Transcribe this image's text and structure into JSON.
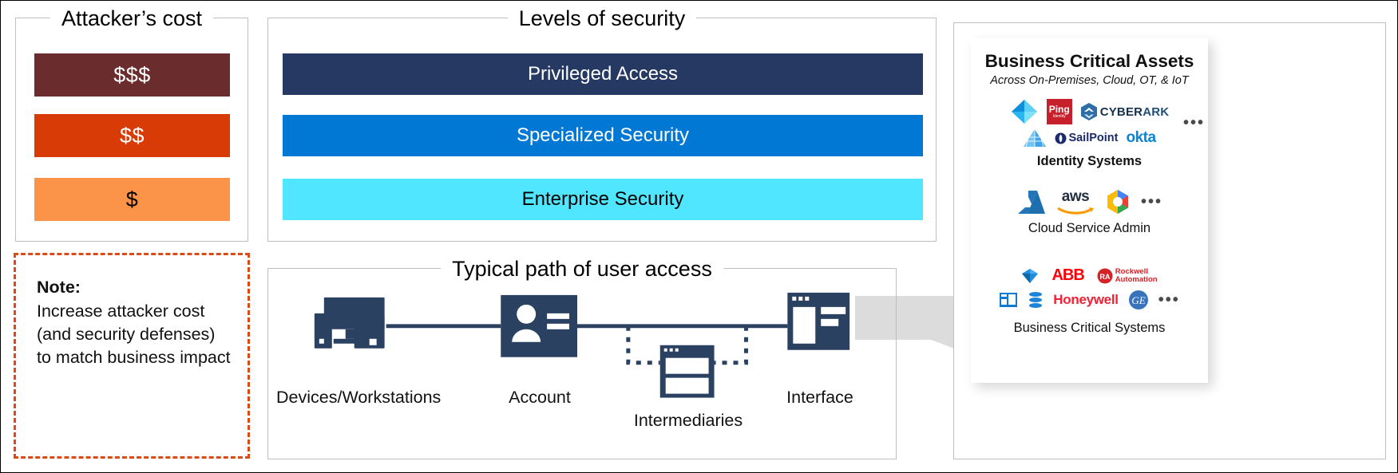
{
  "attacker_cost": {
    "title": "Attacker’s cost",
    "bars": [
      {
        "label": "$$$",
        "color": "#6a2c2c"
      },
      {
        "label": "$$",
        "color": "#d93b07"
      },
      {
        "label": "$",
        "color": "#fb9449"
      }
    ]
  },
  "note": {
    "heading": "Note:",
    "body": "Increase attacker cost (and security defenses) to match business impact",
    "border_color": "#d94b18"
  },
  "levels": {
    "title": "Levels of security",
    "bars": [
      {
        "label": "Privileged Access",
        "color": "#263963"
      },
      {
        "label": "Specialized Security",
        "color": "#0078d4"
      },
      {
        "label": "Enterprise Security",
        "color": "#50e6ff"
      }
    ]
  },
  "path": {
    "title": "Typical path of user access",
    "nodes": [
      {
        "label": "Devices/Workstations",
        "icon": "workstation-icon"
      },
      {
        "label": "Account",
        "icon": "account-card-icon"
      },
      {
        "label": "Intermediaries",
        "icon": "intermediary-window-icon"
      },
      {
        "label": "Interface",
        "icon": "interface-window-icon"
      }
    ]
  },
  "assets": {
    "title": "Business Critical Assets",
    "subtitle": "Across On-Premises, Cloud, OT, & IoT",
    "groups": [
      {
        "caption": "Identity Systems",
        "logos": [
          "azure-ad-diamond-icon",
          "ping-identity-logo",
          "cyberark-logo",
          "adfs-pyramid-icon",
          "sailpoint-logo",
          "okta-logo",
          "more-dots-icon"
        ],
        "logo_text": {
          "ping": "Ping",
          "ping_sub": "Identity",
          "cyberark_a": "CYBER",
          "cyberark_b": "ARK",
          "sailpoint": "SailPoint",
          "okta": "okta",
          "dots": "•••"
        }
      },
      {
        "caption": "Cloud Service Admin",
        "logos": [
          "azure-logo",
          "aws-logo",
          "google-cloud-logo",
          "more-dots-icon"
        ],
        "logo_text": {
          "aws": "aws",
          "dots": "•••"
        }
      },
      {
        "caption": "Business Critical Systems",
        "logos": [
          "sap-diamond-icon",
          "abb-logo",
          "rockwell-automation-logo",
          "dynamics-icon",
          "oracle-db-icon",
          "honeywell-logo",
          "ge-logo",
          "more-dots-icon"
        ],
        "logo_text": {
          "abb": "ABB",
          "rockwell_1": "Rockwell",
          "rockwell_2": "Automation",
          "rockwell_mark": "RA",
          "honeywell": "Honeywell",
          "ge": "GE",
          "dots": "•••"
        }
      }
    ]
  },
  "colors": {
    "frame": "#bfbfbf",
    "icon_navy": "#2b4162",
    "funnel_gray": "#dcdcdc"
  }
}
